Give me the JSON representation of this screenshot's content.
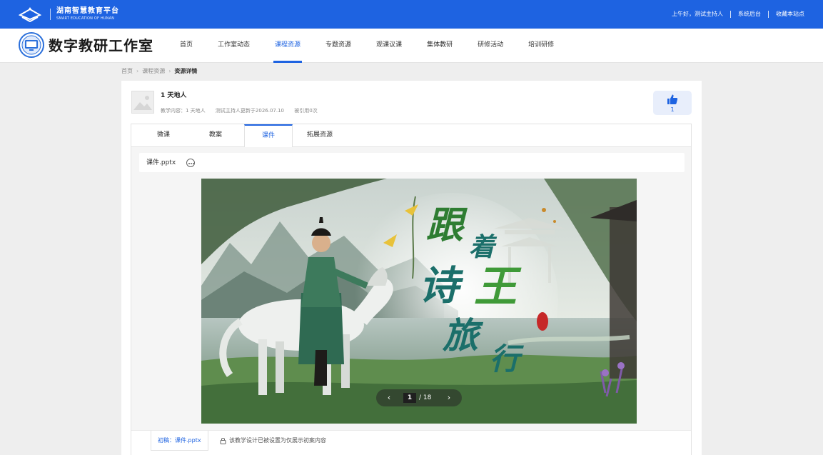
{
  "topbar": {
    "platform_name": "湖南智慧教育平台",
    "platform_subtitle": "SMART EDUCATION OF HUNAN",
    "greeting": "上午好，测试主持人",
    "admin_link": "系统后台",
    "bookmark_link": "收藏本站点"
  },
  "header": {
    "studio_title": "数字教研工作室",
    "nav": [
      {
        "label": "首页"
      },
      {
        "label": "工作室动态"
      },
      {
        "label": "课程资源"
      },
      {
        "label": "专题资源"
      },
      {
        "label": "观课议课"
      },
      {
        "label": "集体教研"
      },
      {
        "label": "研修活动"
      },
      {
        "label": "培训研修"
      }
    ],
    "active_nav": 2
  },
  "breadcrumb": {
    "items": [
      "首页",
      "课程资源"
    ],
    "current": "资源详情",
    "separator": "›"
  },
  "resource": {
    "title": "1 天地人",
    "meta_content": "教学内容：1 天地人",
    "meta_updated": "测试主持人更新于2026.07.10",
    "meta_cited": "被引用0次",
    "likes": "1"
  },
  "tabs": [
    {
      "label": "微课"
    },
    {
      "label": "教案"
    },
    {
      "label": "课件"
    },
    {
      "label": "拓展资源"
    }
  ],
  "active_tab": 2,
  "viewer": {
    "file_name": "课件.pptx",
    "slide_title_chars": [
      "跟",
      "着",
      "诗",
      "王",
      "旅",
      "行"
    ],
    "current_page": "1",
    "total_pages": "/ 18",
    "prev_glyph": "‹",
    "next_glyph": "›"
  },
  "footer": {
    "draft_label": "初稿：课件.pptx",
    "lock_note": "该教学设计已被设置为仅展示初案内容"
  },
  "colors": {
    "brand_blue": "#1e63e1",
    "title_green": "#2e7d32",
    "title_teal": "#1b6f6a"
  }
}
